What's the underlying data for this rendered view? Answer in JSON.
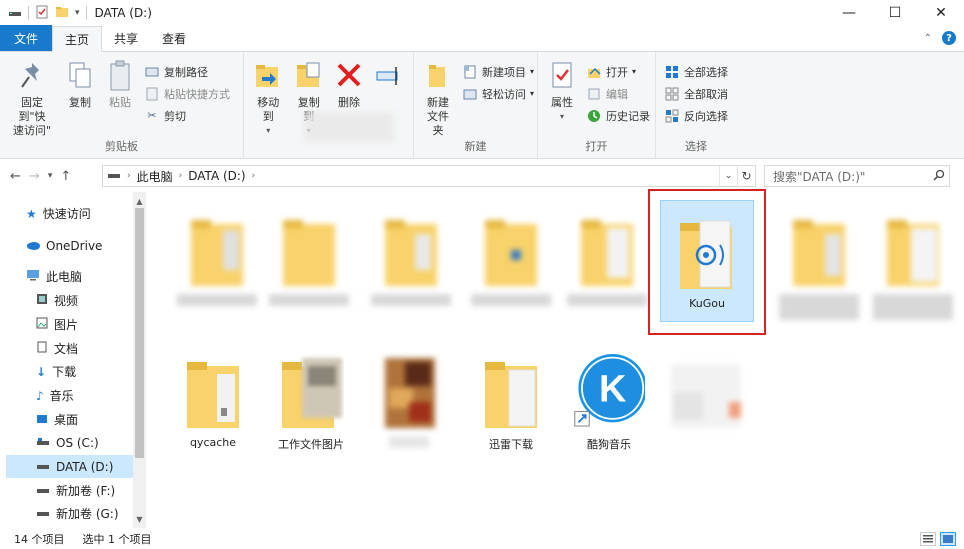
{
  "window": {
    "title": "DATA (D:)",
    "controls": [
      "—",
      "☐",
      "✕"
    ]
  },
  "tabs": {
    "file": "文件",
    "home": "主页",
    "share": "共享",
    "view": "查看"
  },
  "ribbon": {
    "clipboard": {
      "pin": "固定到\"快\n速访问\"",
      "copy": "复制",
      "paste": "粘贴",
      "copy_path": "复制路径",
      "paste_shortcut": "粘贴快捷方式",
      "cut": "剪切",
      "label": "剪贴板"
    },
    "organize": {
      "move_to": "移动到",
      "copy_to": "复制到",
      "delete": "删除"
    },
    "new": {
      "new_folder": "新建\n文件夹",
      "new_item": "新建项目",
      "easy_access": "轻松访问",
      "label": "新建"
    },
    "open": {
      "properties": "属性",
      "open": "打开",
      "edit": "编辑",
      "history": "历史记录",
      "label": "打开"
    },
    "select": {
      "select_all": "全部选择",
      "select_none": "全部取消",
      "invert": "反向选择",
      "label": "选择"
    }
  },
  "address": {
    "this_pc": "此电脑",
    "drive": "DATA (D:)",
    "search_placeholder": "搜索\"DATA (D:)\""
  },
  "nav_pane": {
    "items": [
      {
        "label": "快速访问",
        "icon": "star-icon"
      },
      {
        "label": "OneDrive",
        "icon": "cloud-icon"
      },
      {
        "label": "此电脑",
        "icon": "computer-icon"
      },
      {
        "label": "视频",
        "icon": "video-icon"
      },
      {
        "label": "图片",
        "icon": "pictures-icon"
      },
      {
        "label": "文档",
        "icon": "documents-icon"
      },
      {
        "label": "下载",
        "icon": "download-icon"
      },
      {
        "label": "音乐",
        "icon": "music-icon"
      },
      {
        "label": "桌面",
        "icon": "desktop-icon"
      },
      {
        "label": "OS (C:)",
        "icon": "drive-c-icon"
      },
      {
        "label": "DATA (D:)",
        "icon": "drive-icon"
      },
      {
        "label": "新加卷 (F:)",
        "icon": "drive-icon"
      },
      {
        "label": "新加卷 (G:)",
        "icon": "drive-icon"
      }
    ]
  },
  "files": {
    "kugou": "KuGou",
    "qycache": "qycache",
    "work_pics": "工作文件图片",
    "xunlei": "迅雷下载",
    "kugou_music": "酷狗音乐"
  },
  "status": {
    "count": "14 个项目",
    "selected": "选中 1 个项目"
  },
  "colors": {
    "accent": "#1979ca",
    "selection": "#cce8ff",
    "highlight_box": "#d62222",
    "folder": "#f8d26a"
  }
}
